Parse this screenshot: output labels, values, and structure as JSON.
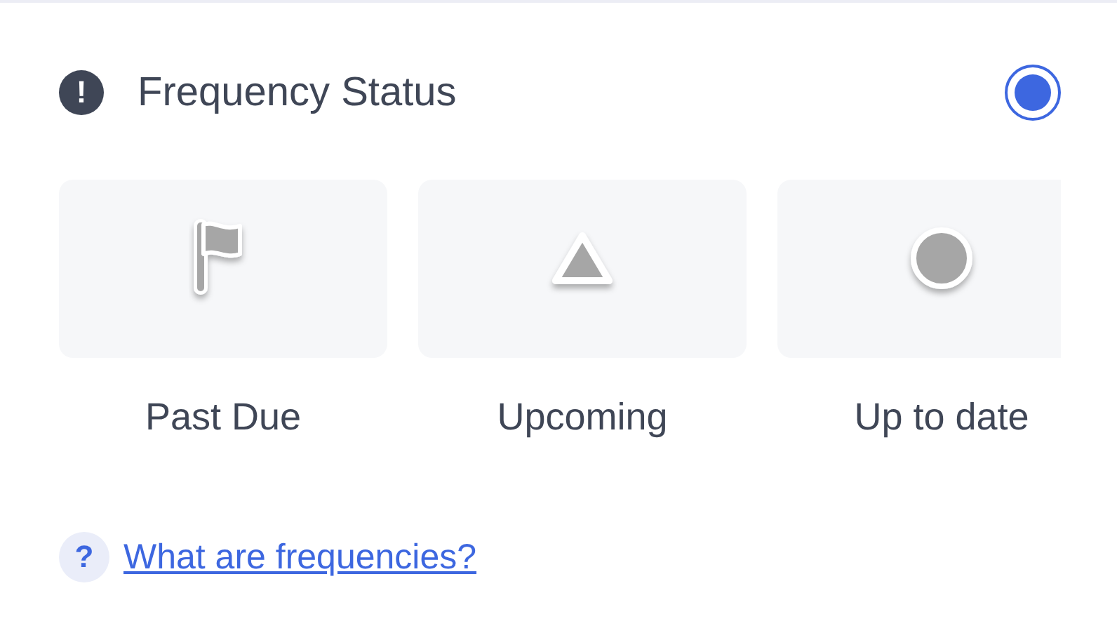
{
  "header": {
    "icon": "!",
    "title": "Frequency Status",
    "radio": {
      "selected": true
    }
  },
  "options": [
    {
      "kind": "flag",
      "label": "Past Due"
    },
    {
      "kind": "triangle",
      "label": "Upcoming"
    },
    {
      "kind": "circle",
      "label": "Up to date"
    }
  ],
  "help": {
    "icon": "?",
    "link": "What are frequencies?"
  }
}
